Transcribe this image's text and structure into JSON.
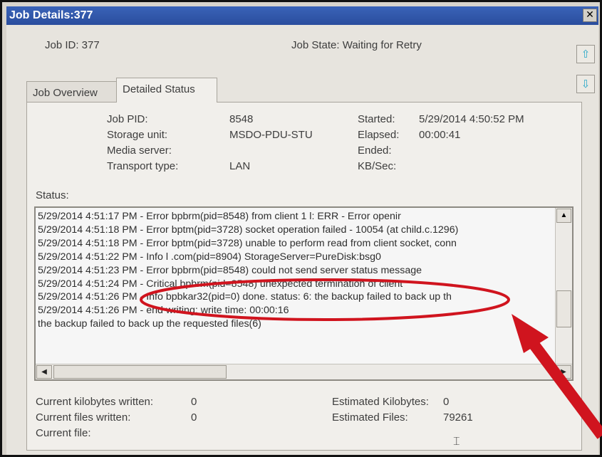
{
  "window": {
    "title": "Job Details:377",
    "close_glyph": "✕"
  },
  "header": {
    "job_id": "Job ID: 377",
    "job_state": "Job State: Waiting for Retry"
  },
  "nav": {
    "up_icon": "arrow-up-icon",
    "down_icon": "arrow-down-icon",
    "up_glyph": "⇧",
    "down_glyph": "⇩"
  },
  "tabs": [
    {
      "label": "Job Overview",
      "active": false
    },
    {
      "label": "Detailed Status",
      "active": true
    }
  ],
  "details": {
    "job_pid_label": "Job PID:",
    "job_pid_value": "8548",
    "storage_unit_label": "Storage unit:",
    "storage_unit_value": "MSDO-PDU-STU",
    "media_server_label": "Media server:",
    "media_server_value": "",
    "transport_type_label": "Transport type:",
    "transport_type_value": "LAN",
    "started_label": "Started:",
    "started_value": "5/29/2014 4:50:52 PM",
    "elapsed_label": "Elapsed:",
    "elapsed_value": "00:00:41",
    "ended_label": "Ended:",
    "ended_value": "",
    "kbsec_label": "KB/Sec:",
    "kbsec_value": ""
  },
  "status": {
    "label": "Status:",
    "lines": [
      "5/29/2014 4:51:17 PM - Error bpbrm(pid=8548) from client 1                    l: ERR - Error openir",
      "5/29/2014 4:51:18 PM - Error bptm(pid=3728) socket operation failed - 10054 (at child.c.1296)",
      "5/29/2014 4:51:18 PM - Error bptm(pid=3728) unable to perform read from client socket, conn",
      "5/29/2014 4:51:22 PM - Info l                              .com(pid=8904) StorageServer=PureDisk:bsg0",
      "5/29/2014 4:51:23 PM - Error bpbrm(pid=8548) could not send server status message",
      "5/29/2014 4:51:24 PM - Critical bpbrm(pid=8548) unexpected termination of client",
      "5/29/2014 4:51:26 PM - Info bpbkar32(pid=0) done. status: 6: the backup failed to back up th",
      "5/29/2014 4:51:26 PM - end writing; write time: 00:00:16",
      "the backup failed to back up the requested files(6)"
    ]
  },
  "footer": {
    "current_kb_label": "Current kilobytes written:",
    "current_kb_value": "0",
    "current_files_label": "Current files written:",
    "current_files_value": "0",
    "current_file_label": "Current file:",
    "estimated_kb_label": "Estimated Kilobytes:",
    "estimated_kb_value": "0",
    "estimated_files_label": "Estimated Files:",
    "estimated_files_value": "79261"
  },
  "annotation": {
    "ellipse_color": "#d0141e",
    "arrow_color": "#d0141e"
  }
}
